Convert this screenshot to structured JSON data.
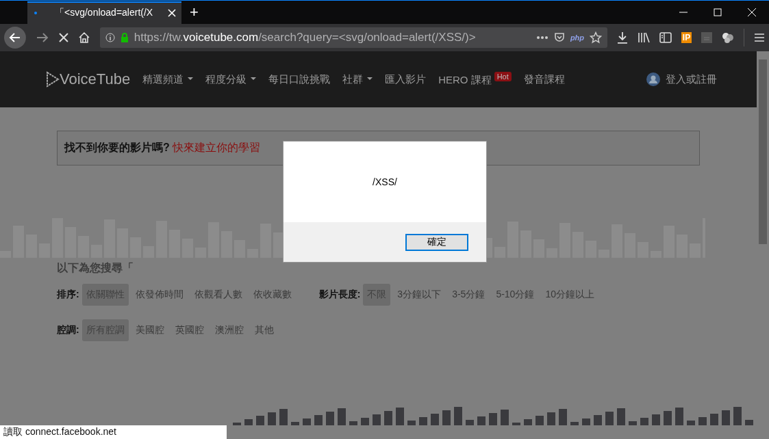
{
  "browser": {
    "tab": {
      "title": "「<svg/onload=alert(/X",
      "selected": true
    },
    "new_tab": "+",
    "url": {
      "prefix": "https://tw.",
      "domain": "voicetube.com",
      "path": "/search?query=<svg/onload=alert(/XSS/)>"
    },
    "php_badge": "php",
    "ip_badge": "IP"
  },
  "site": {
    "logo": "VoiceTube",
    "nav": [
      {
        "label": "精選頻道",
        "dropdown": true
      },
      {
        "label": "程度分級",
        "dropdown": true
      },
      {
        "label": "每日口說挑戰",
        "dropdown": false
      },
      {
        "label": "社群",
        "dropdown": true
      },
      {
        "label": "匯入影片",
        "dropdown": false
      },
      {
        "label": "HERO 課程",
        "dropdown": false,
        "badge": "Hot"
      },
      {
        "label": "發音課程",
        "dropdown": false
      }
    ],
    "login": "登入或註冊"
  },
  "banner": {
    "question": "找不到你要的影片嗎?",
    "link": "快來建立你的學習"
  },
  "results_heading": "以下為您搜尋「",
  "filters": [
    {
      "label": "排序:",
      "options": [
        {
          "label": "依關聯性",
          "selected": true
        },
        {
          "label": "依發佈時間",
          "selected": false
        },
        {
          "label": "依觀看人數",
          "selected": false
        },
        {
          "label": "依收藏數",
          "selected": false
        }
      ]
    },
    {
      "label": "影片長度:",
      "options": [
        {
          "label": "不限",
          "selected": true
        },
        {
          "label": "3分鐘以下",
          "selected": false
        },
        {
          "label": "3-5分鐘",
          "selected": false
        },
        {
          "label": "5-10分鐘",
          "selected": false
        },
        {
          "label": "10分鐘以上",
          "selected": false
        }
      ]
    },
    {
      "label": "腔調:",
      "options": [
        {
          "label": "所有腔調",
          "selected": true
        },
        {
          "label": "美國腔",
          "selected": false
        },
        {
          "label": "英國腔",
          "selected": false
        },
        {
          "label": "澳洲腔",
          "selected": false
        },
        {
          "label": "其他",
          "selected": false
        }
      ]
    }
  ],
  "dialog": {
    "message": "/XSS/",
    "button": "確定"
  },
  "status_bar": "讀取 connect.facebook.net"
}
